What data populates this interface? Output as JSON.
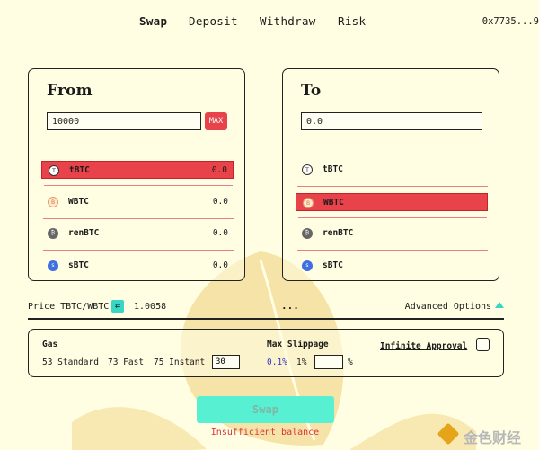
{
  "nav": {
    "tabs": [
      "Swap",
      "Deposit",
      "Withdraw",
      "Risk"
    ],
    "active": "Swap",
    "wallet_address": "0x7735...9"
  },
  "from": {
    "title": "From",
    "amount": "10000",
    "max_label": "MAX",
    "tokens": [
      {
        "name": "tBTC",
        "balance": "0.0",
        "icon": "tbtc-icon",
        "selected": true
      },
      {
        "name": "WBTC",
        "balance": "0.0",
        "icon": "wbtc-icon",
        "selected": false
      },
      {
        "name": "renBTC",
        "balance": "0.0",
        "icon": "renbtc-icon",
        "selected": false
      },
      {
        "name": "sBTC",
        "balance": "0.0",
        "icon": "sbtc-icon",
        "selected": false
      }
    ]
  },
  "to": {
    "title": "To",
    "amount": "0.0",
    "tokens": [
      {
        "name": "tBTC",
        "icon": "tbtc-icon",
        "selected": false
      },
      {
        "name": "WBTC",
        "icon": "wbtc-icon",
        "selected": true
      },
      {
        "name": "renBTC",
        "icon": "renbtc-icon",
        "selected": false
      },
      {
        "name": "sBTC",
        "icon": "sbtc-icon",
        "selected": false
      }
    ]
  },
  "price": {
    "label": "Price TBTC/WBTC",
    "value": "1.0058",
    "dots": "...",
    "advanced_label": "Advanced Options"
  },
  "options": {
    "gas_title": "Gas",
    "gas_standard": "53 Standard",
    "gas_fast": "73 Fast",
    "gas_instant": "75 Instant",
    "gas_custom_value": "30",
    "slippage_title": "Max Slippage",
    "slippage_a": "0.1%",
    "slippage_b": "1%",
    "slippage_custom_value": "",
    "percent_sign": "%",
    "infinite_approval_label": "Infinite Approval"
  },
  "action": {
    "swap_label": "Swap",
    "error_text": "Insufficient balance"
  },
  "watermark": {
    "text": "金色财经"
  },
  "colors": {
    "background": "#fffde2",
    "selected_row": "#e8434a",
    "accent_teal": "#58f0d2",
    "error": "#d9343b",
    "link": "#3a34c8"
  }
}
